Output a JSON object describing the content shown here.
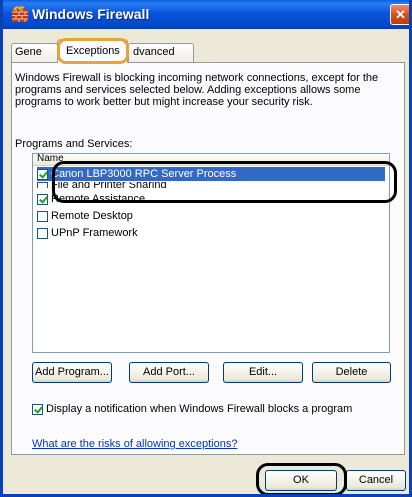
{
  "window": {
    "title": "Windows Firewall",
    "close_glyph": "✕",
    "title_bar_color": "#0548c9"
  },
  "tabs": [
    {
      "label": "Gene",
      "full_label": "General"
    },
    {
      "label": "Exceptions"
    },
    {
      "label": "Advanced",
      "visible": "dvanced"
    }
  ],
  "description": "Windows Firewall is blocking incoming network connections, except for the programs and services selected below. Adding exceptions allows some programs to work better but might increase your security risk.",
  "programs_label": "Programs and Services:",
  "list": {
    "header": "Name",
    "items": [
      {
        "label": "Canon LBP3000 RPC Server Process",
        "checked": true,
        "selected": true
      },
      {
        "label": "File and Printer Sharing",
        "checked": false,
        "selected": false
      },
      {
        "label": "Remote Assistance",
        "checked": true,
        "selected": false
      },
      {
        "label": "Remote Desktop",
        "checked": false,
        "selected": false
      },
      {
        "label": "UPnP Framework",
        "checked": false,
        "selected": false
      }
    ]
  },
  "buttons": {
    "add_program": "Add Program...",
    "add_port": "Add Port...",
    "edit": "Edit...",
    "delete": "Delete",
    "ok": "OK",
    "cancel": "Cancel"
  },
  "notification_label": "Display a notification when Windows Firewall blocks a program",
  "notification_checked": true,
  "risk_link": "What are the risks of allowing exceptions?",
  "colors": {
    "selection": "#316ac5",
    "link": "#0033cc",
    "dialog_bg": "#ece9d8",
    "annotation_tab": "#e8a33a"
  }
}
